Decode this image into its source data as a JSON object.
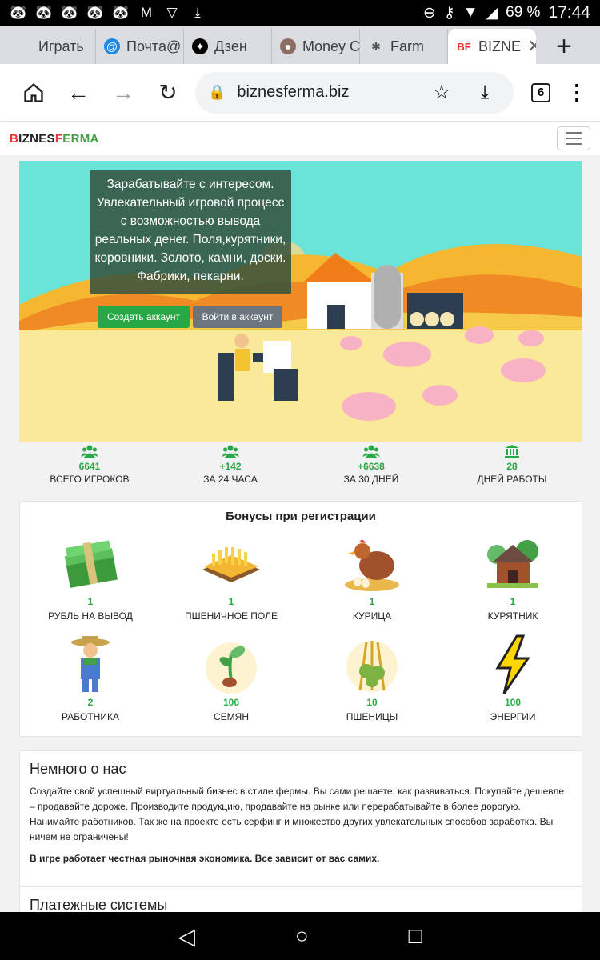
{
  "status_bar": {
    "battery": "69 %",
    "time": "17:44"
  },
  "tabs": [
    {
      "label": "Играть",
      "favicon": "grid-icon"
    },
    {
      "label": "Почта@",
      "favicon": "at-icon"
    },
    {
      "label": "Дзен",
      "favicon": "zen-icon"
    },
    {
      "label": "Money C",
      "favicon": "money-icon"
    },
    {
      "label": "Farm",
      "favicon": "farm-icon"
    },
    {
      "label": "BIZNE",
      "favicon": "bf-icon"
    }
  ],
  "address_bar": {
    "url": "biznesferma.biz",
    "tab_count": "6"
  },
  "site": {
    "logo_parts": [
      "B",
      "IZNES",
      "F",
      "ERMA"
    ]
  },
  "hero": {
    "text": "Зарабатывайте с интересом. Увлекательный игровой процесс с возможностью вывода реальных денег. Поля,курятники, коровники. Золото, камни, доски. Фабрики, пекарни.",
    "create_button": "Создать аккаунт",
    "login_button": "Войти в аккаунт"
  },
  "stats": [
    {
      "value": "6641",
      "label": "ВСЕГО ИГРОКОВ",
      "icon": "users-icon"
    },
    {
      "value": "+142",
      "label": "ЗА 24 ЧАСА",
      "icon": "users-icon"
    },
    {
      "value": "+6638",
      "label": "ЗА 30 ДНЕЙ",
      "icon": "users-icon"
    },
    {
      "value": "28",
      "label": "ДНЕЙ РАБОТЫ",
      "icon": "bank-icon"
    }
  ],
  "bonuses": {
    "title": "Бонусы при регистрации",
    "items": [
      {
        "value": "1",
        "label": "РУБЛЬ НА ВЫВОД",
        "icon": "money-stack-icon"
      },
      {
        "value": "1",
        "label": "ПШЕНИЧНОЕ ПОЛЕ",
        "icon": "wheat-field-icon"
      },
      {
        "value": "1",
        "label": "КУРИЦА",
        "icon": "chicken-icon"
      },
      {
        "value": "1",
        "label": "КУРЯТНИК",
        "icon": "henhouse-icon"
      },
      {
        "value": "2",
        "label": "РАБОТНИКА",
        "icon": "farmer-icon"
      },
      {
        "value": "100",
        "label": "СЕМЯН",
        "icon": "sprout-icon"
      },
      {
        "value": "10",
        "label": "ПШЕНИЦЫ",
        "icon": "wheat-icon"
      },
      {
        "value": "100",
        "label": "ЭНЕРГИИ",
        "icon": "lightning-icon"
      }
    ]
  },
  "about": {
    "title": "Немного о нас",
    "text": "Создайте свой успешный виртуальный бизнес в стиле фермы. Вы сами решаете, как развиваться. Покупайте дешевле – продавайте дороже. Производите продукцию, продавайте на рынке или перерабатывайте в более дорогую. Нанимайте работников. Так же на проекте есть серфинг и множество других увлекательных способов заработка. Вы ничем не ограничены!",
    "bold_text": "В игре работает честная рыночная экономика. Все зависит от вас самих."
  },
  "payments": {
    "title": "Платежные системы"
  }
}
